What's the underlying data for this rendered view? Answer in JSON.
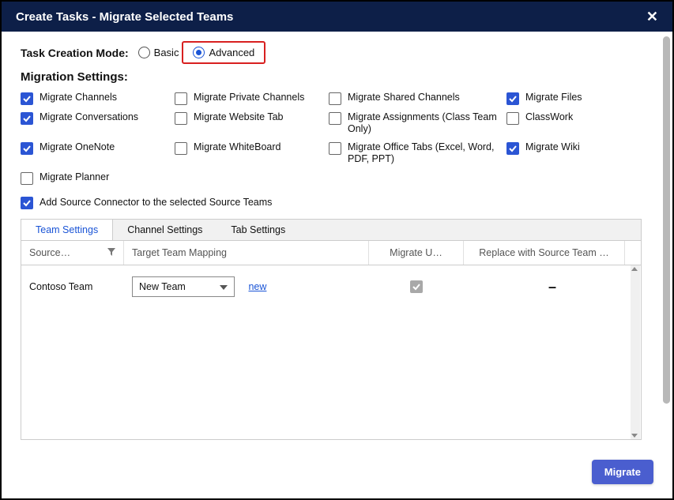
{
  "header": {
    "title": "Create Tasks - Migrate Selected Teams"
  },
  "mode": {
    "label": "Task Creation Mode:",
    "basic": "Basic",
    "advanced": "Advanced",
    "selected": "advanced"
  },
  "section": {
    "migration_settings": "Migration Settings:"
  },
  "settings": {
    "migrate_channels": {
      "label": "Migrate Channels",
      "checked": true
    },
    "migrate_private": {
      "label": "Migrate Private Channels",
      "checked": false
    },
    "migrate_shared": {
      "label": "Migrate Shared Channels",
      "checked": false
    },
    "migrate_files": {
      "label": "Migrate Files",
      "checked": true
    },
    "migrate_conversations": {
      "label": "Migrate Conversations",
      "checked": true
    },
    "migrate_website": {
      "label": "Migrate Website Tab",
      "checked": false
    },
    "migrate_assignments": {
      "label": "Migrate Assignments (Class Team Only)",
      "checked": false
    },
    "classwork": {
      "label": "ClassWork",
      "checked": false
    },
    "migrate_onenote": {
      "label": "Migrate OneNote",
      "checked": true
    },
    "migrate_whiteboard": {
      "label": "Migrate WhiteBoard",
      "checked": false
    },
    "migrate_office_tabs": {
      "label": "Migrate Office Tabs (Excel, Word, PDF, PPT)",
      "checked": false
    },
    "migrate_wiki": {
      "label": "Migrate Wiki",
      "checked": true
    },
    "migrate_planner": {
      "label": "Migrate Planner",
      "checked": false
    }
  },
  "source_connector": {
    "label": "Add Source Connector to the selected Source Teams",
    "checked": true
  },
  "tabs": {
    "team_settings": "Team Settings",
    "channel_settings": "Channel Settings",
    "tab_settings": "Tab Settings",
    "active": "team_settings"
  },
  "grid": {
    "headers": {
      "source": "Source…",
      "target": "Target Team Mapping",
      "migrate": "Migrate U…",
      "replace": "Replace with Source Team …"
    },
    "rows": [
      {
        "source_team": "Contoso Team",
        "target": "New Team",
        "new_link": "new",
        "migrate_users": true,
        "replace": "–"
      }
    ]
  },
  "footer": {
    "migrate": "Migrate"
  }
}
